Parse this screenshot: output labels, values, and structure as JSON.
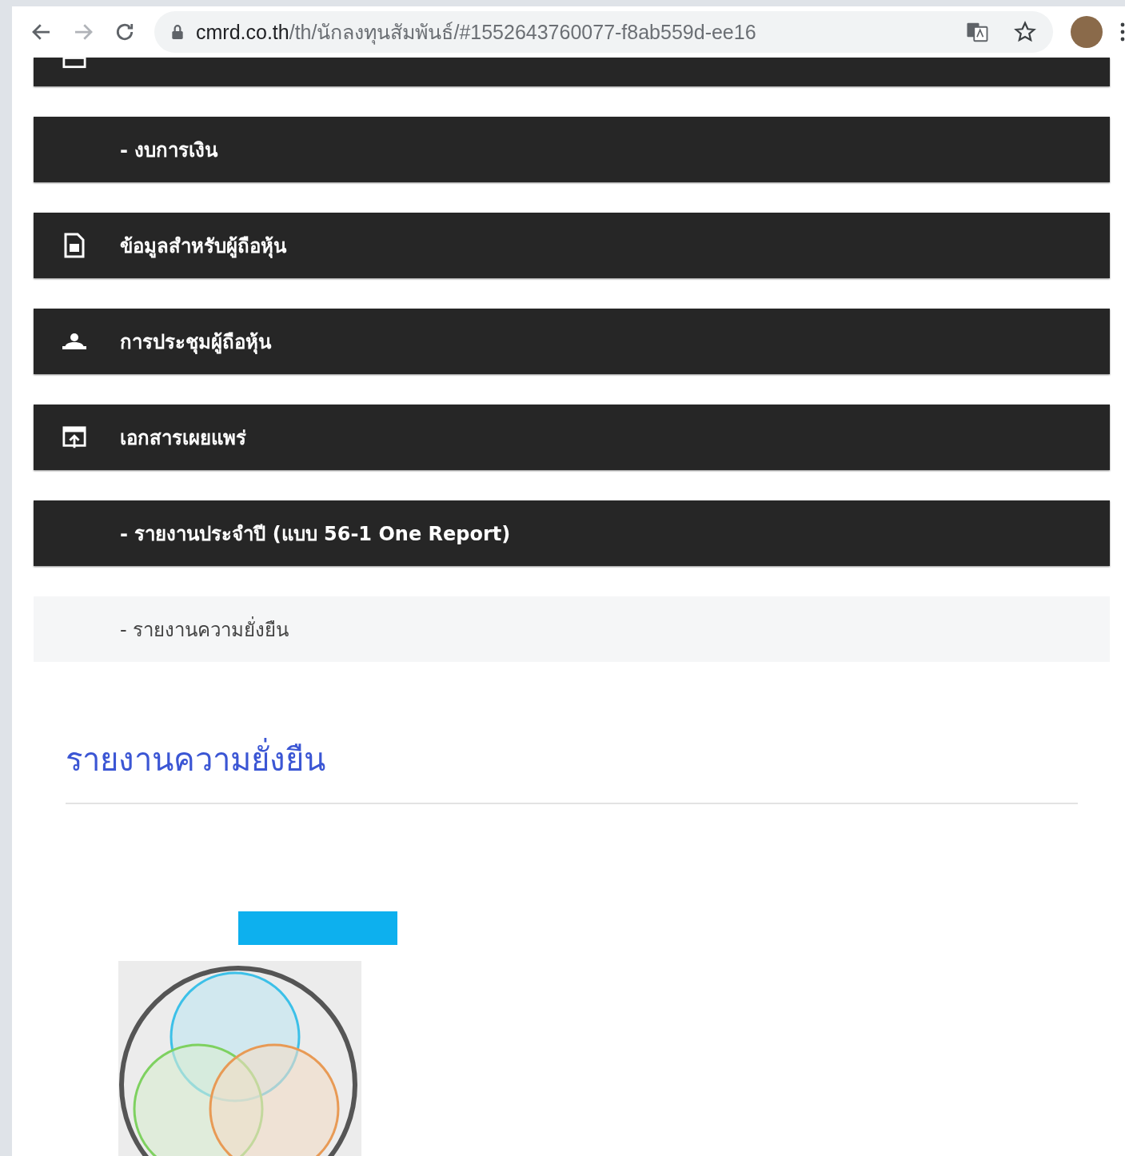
{
  "browser": {
    "url_domain": "cmrd.co.th",
    "url_path": "/th/นักลงทุนสัมพันธ์/#1552643760077-f8ab559d-ee16"
  },
  "menu": [
    {
      "kind": "partial",
      "selected": false
    },
    {
      "kind": "sub",
      "label": "- งบการเงิน",
      "selected": false
    },
    {
      "kind": "document",
      "label": "ข้อมูลสำหรับผู้ถือหุ้น",
      "selected": false
    },
    {
      "kind": "meeting",
      "label": "การประชุมผู้ถือหุ้น",
      "selected": false
    },
    {
      "kind": "publication",
      "label": "เอกสารเผยแพร่",
      "selected": false
    },
    {
      "kind": "sub",
      "label": "- รายงานประจำปี (แบบ 56-1 One Report)",
      "selected": false
    },
    {
      "kind": "sub",
      "label": "- รายงานความยั่งยืน",
      "selected": true
    }
  ],
  "section": {
    "title": "รายงานความยั่งยืน"
  }
}
